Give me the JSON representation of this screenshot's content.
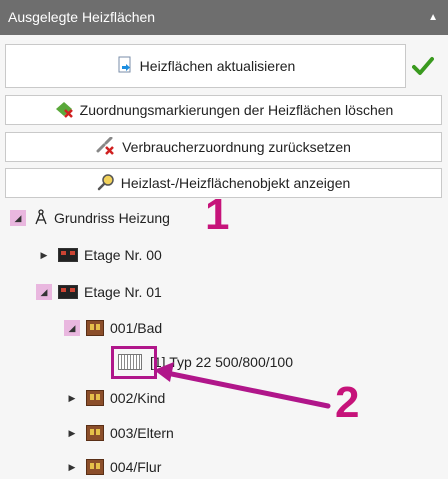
{
  "panel": {
    "title": "Ausgelegte Heizflächen",
    "collapse_glyph": "▲"
  },
  "buttons": {
    "update": "Heizflächen aktualisieren",
    "delete_markers": "Zuordnungsmarkierungen der Heizflächen löschen",
    "reset_assignment": "Verbraucherzuordnung zurücksetzen",
    "show_object": "Heizlast-/Heizflächenobjekt anzeigen"
  },
  "icons": {
    "update": "refresh-document-icon",
    "delete_markers": "eraser-icon",
    "reset_assignment": "unlink-icon",
    "show_object": "magnifier-icon",
    "check": "checkmark-icon",
    "root": "compass-icon",
    "floor": "floor-icon",
    "room": "room-icon",
    "radiator": "radiator-icon"
  },
  "tree": {
    "root": "Grundriss Heizung",
    "floors": [
      {
        "label": "Etage Nr. 00",
        "expanded": false
      },
      {
        "label": "Etage Nr. 01",
        "expanded": true
      }
    ],
    "rooms": [
      {
        "label": "001/Bad",
        "expanded": true
      },
      {
        "label": "002/Kind",
        "expanded": false
      },
      {
        "label": "003/Eltern",
        "expanded": false
      },
      {
        "label": "004/Flur",
        "expanded": false
      }
    ],
    "radiator": "[1] Typ 22 500/800/100"
  },
  "annotations": {
    "marker1": "1",
    "marker2": "2"
  },
  "colors": {
    "header_bg": "#6e6e6e",
    "highlight": "#e9b7df",
    "annotation": "#c6137a",
    "check": "#3a9a1f"
  }
}
